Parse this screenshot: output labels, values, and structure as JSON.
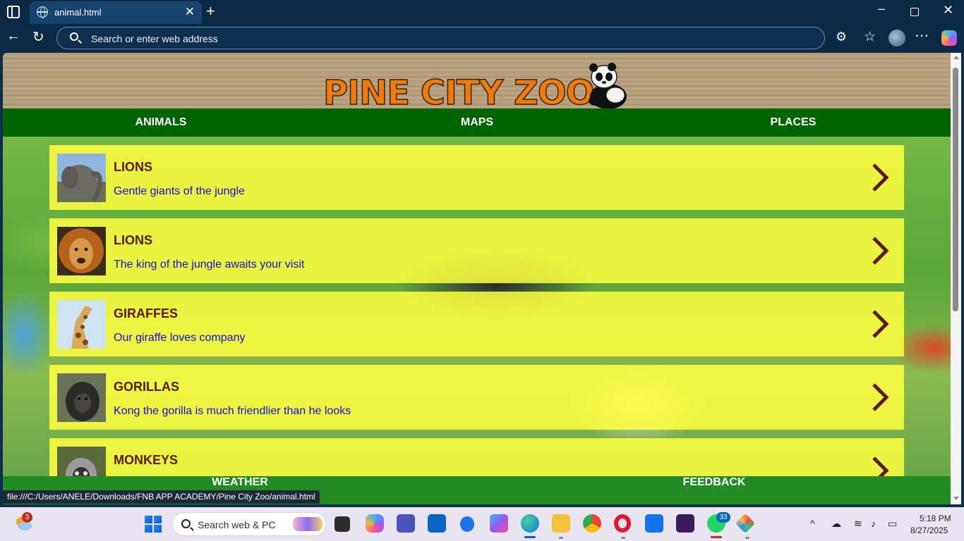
{
  "browser": {
    "tab_title": "animal.html",
    "address_placeholder": "Search or enter web address",
    "status_url": "file:///C:/Users/ANELE/Downloads/FNB APP ACADEMY/Pine City Zoo/animal.html"
  },
  "site": {
    "logo_text": "PINE CITY ZOO",
    "top_nav": [
      "ANIMALS",
      "MAPS",
      "PLACES"
    ],
    "bottom_nav": [
      "WEATHER",
      "FEEDBACK"
    ],
    "cards": [
      {
        "title": "LIONS",
        "desc": "Gentle giants of the jungle",
        "thumb": "elephant-photo"
      },
      {
        "title": "LIONS",
        "desc": "The king of the jungle awaits your visit",
        "thumb": "lion-photo"
      },
      {
        "title": "GIRAFFES",
        "desc": "Our giraffe loves company",
        "thumb": "giraffe-photo"
      },
      {
        "title": "GORILLAS",
        "desc": "Kong the gorilla is much friendlier than he looks",
        "thumb": "gorilla-photo"
      },
      {
        "title": "MONKEYS",
        "desc": "",
        "thumb": "monkey-photo"
      }
    ],
    "colors": {
      "top_nav": "#006400",
      "bottom_nav": "#228b22",
      "card": "#ffff40",
      "card_title": "#5a1a0a",
      "card_desc": "#1212d8",
      "logo": "#f07b0c"
    }
  },
  "taskbar": {
    "search_placeholder": "Search web & PC",
    "weather_badge": "3",
    "whatsapp_badge": "33",
    "clock_time": "5:18 PM",
    "clock_date": "8/27/2025"
  }
}
